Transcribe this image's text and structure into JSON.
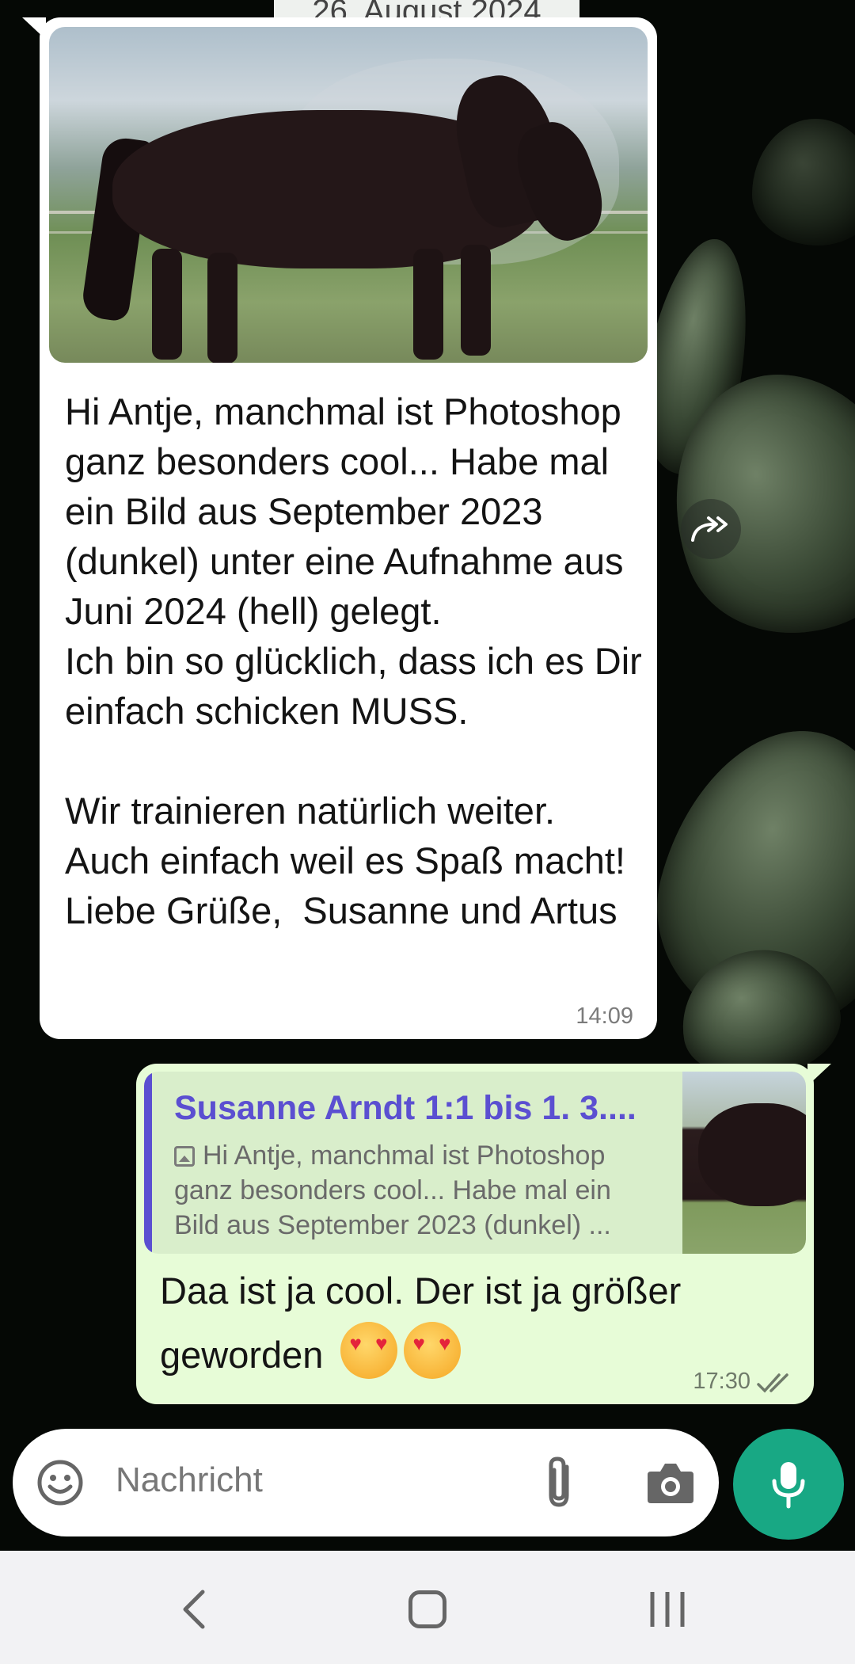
{
  "chat": {
    "date_chip": "26. August 2024"
  },
  "incoming_message": {
    "text": "Hi Antje, manchmal ist Photoshop ganz besonders cool... Habe mal ein Bild aus September 2023 (dunkel) unter eine Aufnahme aus Juni 2024 (hell) gelegt.\nIch bin so glücklich, dass ich es Dir einfach schicken MUSS.\n\nWir trainieren natürlich weiter. Auch einfach weil es Spaß macht! Liebe Grüße,  Susanne und Artus",
    "time": "14:09"
  },
  "outgoing_message": {
    "quote_name": "Susanne Arndt 1:1 bis 1. 3....",
    "quote_text": "Hi Antje, manchmal ist Photoshop ganz besonders cool... Habe mal ein Bild aus September 2023 (dunkel) ...",
    "text": "Daa ist ja cool. Der ist ja größer geworden",
    "emoji": "heart-eyes-emoji",
    "time": "17:30",
    "status": "read"
  },
  "composer": {
    "placeholder": "Nachricht"
  },
  "icons": {
    "forward": "forward-icon",
    "emoji": "smiley-icon",
    "attach": "paperclip-icon",
    "camera": "camera-icon",
    "mic": "mic-icon",
    "quote_image": "image-icon"
  },
  "colors": {
    "incoming_bubble": "#ffffff",
    "outgoing_bubble": "#e7fcd7",
    "quote_accent": "#5b4fd1",
    "mic_button": "#18a884"
  }
}
